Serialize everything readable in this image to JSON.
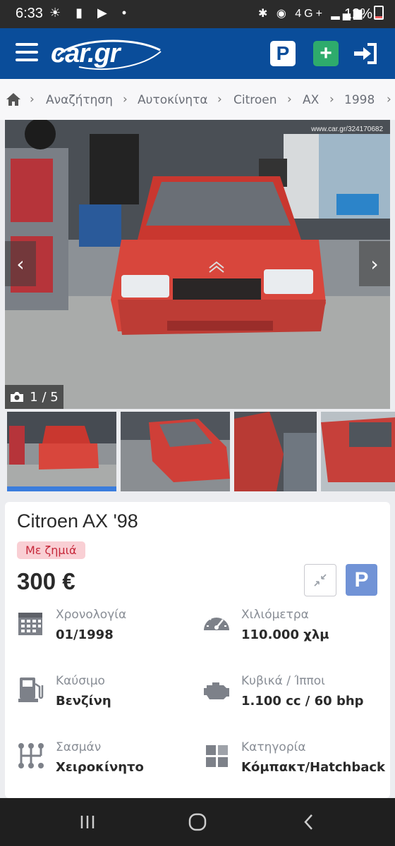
{
  "status_bar": {
    "time": "6:33",
    "battery": "12%",
    "network": "4G+"
  },
  "header": {
    "logo_text": "car.gr",
    "parking_label": "P",
    "add_label": "+"
  },
  "breadcrumb": [
    "Αναζήτηση",
    "Αυτοκίνητα",
    "Citroen",
    "AX",
    "1998"
  ],
  "gallery": {
    "counter": "1 / 5",
    "watermark": "www.car.gr/324170682",
    "thumbnail_count": 4,
    "active_thumbnail": 1
  },
  "listing": {
    "title": "Citroen AX '98",
    "badge": "Με ζημιά",
    "price": "300 €",
    "parking_label": "P",
    "specs": [
      {
        "icon": "calendar-icon",
        "label": "Χρονολογία",
        "value": "01/1998"
      },
      {
        "icon": "speedometer-icon",
        "label": "Χιλιόμετρα",
        "value": "110.000 χλμ"
      },
      {
        "icon": "fuel-pump-icon",
        "label": "Καύσιμο",
        "value": "Βενζίνη"
      },
      {
        "icon": "engine-icon",
        "label": "Κυβικά / Ίπποι",
        "value": "1.100 cc / 60 bhp"
      },
      {
        "icon": "gearbox-icon",
        "label": "Σασμάν",
        "value": "Χειροκίνητο"
      },
      {
        "icon": "category-icon",
        "label": "Κατηγορία",
        "value": "Κόμπακτ/Hatchback"
      }
    ]
  },
  "colors": {
    "header_bg": "#0a4d9a",
    "badge_bg": "#f9cfd4",
    "badge_text": "#c6283a",
    "accent": "#3b7ddd"
  }
}
